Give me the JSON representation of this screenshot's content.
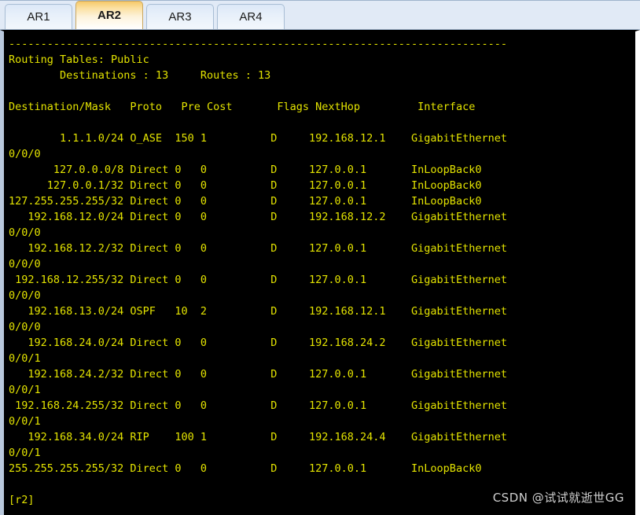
{
  "window": {
    "tabs": [
      {
        "label": "AR1",
        "active": false
      },
      {
        "label": "AR2",
        "active": true
      },
      {
        "label": "AR3",
        "active": false
      },
      {
        "label": "AR4",
        "active": false
      }
    ]
  },
  "terminal": {
    "colors": {
      "background": "#000000",
      "text": "#e3e300",
      "tab_bar_background": "#e1eaf6",
      "active_tab_accent": "#f6c96a",
      "watermark": "#cfcfcf"
    },
    "separator": "------------------------------------------------------------------------------",
    "summary": {
      "title": "Routing Tables: Public",
      "destinations_label": "Destinations",
      "destinations_value": "13",
      "routes_label": "Routes",
      "routes_value": "13"
    },
    "columns": [
      "Destination/Mask",
      "Proto",
      "Pre",
      "Cost",
      "Flags",
      "NextHop",
      "Interface"
    ],
    "rows": [
      {
        "destination": "1.1.1.0/24",
        "proto": "O_ASE",
        "pre": "150",
        "cost": "1",
        "flags": "D",
        "nexthop": "192.168.12.1",
        "interface": "GigabitEthernet",
        "interface_wrap": "0/0/0"
      },
      {
        "destination": "127.0.0.0/8",
        "proto": "Direct",
        "pre": "0",
        "cost": "0",
        "flags": "D",
        "nexthop": "127.0.0.1",
        "interface": "InLoopBack0",
        "interface_wrap": ""
      },
      {
        "destination": "127.0.0.1/32",
        "proto": "Direct",
        "pre": "0",
        "cost": "0",
        "flags": "D",
        "nexthop": "127.0.0.1",
        "interface": "InLoopBack0",
        "interface_wrap": ""
      },
      {
        "destination": "127.255.255.255/32",
        "proto": "Direct",
        "pre": "0",
        "cost": "0",
        "flags": "D",
        "nexthop": "127.0.0.1",
        "interface": "InLoopBack0",
        "interface_wrap": ""
      },
      {
        "destination": "192.168.12.0/24",
        "proto": "Direct",
        "pre": "0",
        "cost": "0",
        "flags": "D",
        "nexthop": "192.168.12.2",
        "interface": "GigabitEthernet",
        "interface_wrap": "0/0/0"
      },
      {
        "destination": "192.168.12.2/32",
        "proto": "Direct",
        "pre": "0",
        "cost": "0",
        "flags": "D",
        "nexthop": "127.0.0.1",
        "interface": "GigabitEthernet",
        "interface_wrap": "0/0/0"
      },
      {
        "destination": "192.168.12.255/32",
        "proto": "Direct",
        "pre": "0",
        "cost": "0",
        "flags": "D",
        "nexthop": "127.0.0.1",
        "interface": "GigabitEthernet",
        "interface_wrap": "0/0/0"
      },
      {
        "destination": "192.168.13.0/24",
        "proto": "OSPF",
        "pre": "10",
        "cost": "2",
        "flags": "D",
        "nexthop": "192.168.12.1",
        "interface": "GigabitEthernet",
        "interface_wrap": "0/0/0"
      },
      {
        "destination": "192.168.24.0/24",
        "proto": "Direct",
        "pre": "0",
        "cost": "0",
        "flags": "D",
        "nexthop": "192.168.24.2",
        "interface": "GigabitEthernet",
        "interface_wrap": "0/0/1"
      },
      {
        "destination": "192.168.24.2/32",
        "proto": "Direct",
        "pre": "0",
        "cost": "0",
        "flags": "D",
        "nexthop": "127.0.0.1",
        "interface": "GigabitEthernet",
        "interface_wrap": "0/0/1"
      },
      {
        "destination": "192.168.24.255/32",
        "proto": "Direct",
        "pre": "0",
        "cost": "0",
        "flags": "D",
        "nexthop": "127.0.0.1",
        "interface": "GigabitEthernet",
        "interface_wrap": "0/0/1"
      },
      {
        "destination": "192.168.34.0/24",
        "proto": "RIP",
        "pre": "100",
        "cost": "1",
        "flags": "D",
        "nexthop": "192.168.24.4",
        "interface": "GigabitEthernet",
        "interface_wrap": "0/0/1"
      },
      {
        "destination": "255.255.255.255/32",
        "proto": "Direct",
        "pre": "0",
        "cost": "0",
        "flags": "D",
        "nexthop": "127.0.0.1",
        "interface": "InLoopBack0",
        "interface_wrap": ""
      }
    ],
    "prompt": "[r2]"
  },
  "watermark": {
    "text": "CSDN @试试就逝世GG"
  }
}
